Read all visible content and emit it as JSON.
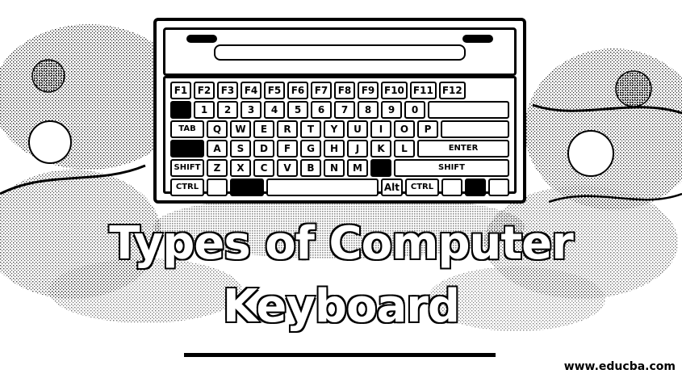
{
  "title": {
    "line1": "Types of Computer",
    "line2": "Keyboard"
  },
  "watermark": "www.educba.com",
  "keyboard": {
    "rows": [
      [
        "F1",
        "F2",
        "F3",
        "F4",
        "F5",
        "F6",
        "F7",
        "F8",
        "F9",
        "F10",
        "F11",
        "F12"
      ],
      [
        "1",
        "2",
        "3",
        "4",
        "5",
        "6",
        "7",
        "8",
        "9",
        "0"
      ],
      [
        "TAB",
        "Q",
        "W",
        "E",
        "R",
        "T",
        "Y",
        "U",
        "I",
        "O",
        "P"
      ],
      [
        "A",
        "S",
        "D",
        "F",
        "G",
        "H",
        "J",
        "K",
        "L",
        "ENTER"
      ],
      [
        "SHIFT",
        "Z",
        "X",
        "C",
        "V",
        "B",
        "N",
        "M",
        "SHIFT"
      ],
      [
        "CTRL",
        "Alt",
        "CTRL"
      ]
    ]
  },
  "colors": {
    "ink": "#000000",
    "paper": "#ffffff"
  }
}
